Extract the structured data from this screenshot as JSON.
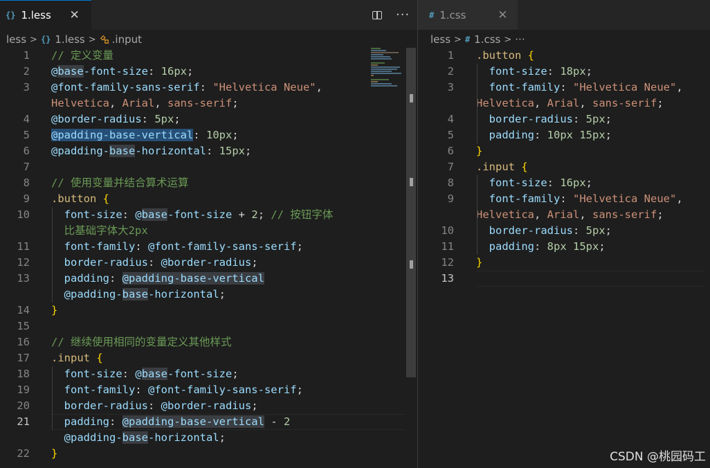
{
  "left": {
    "tab": {
      "label": "1.less",
      "icon": "{}",
      "close": "✕"
    },
    "actions": {
      "split": "split-editor",
      "more": "···"
    },
    "breadcrumb": {
      "folder": "less",
      "file": "1.less",
      "file_icon": "{}",
      "symbol": ".input"
    }
  },
  "right": {
    "tab": {
      "label": "1.css",
      "icon": "#",
      "close": "✕"
    },
    "breadcrumb": {
      "folder": "less",
      "file": "1.css",
      "file_icon": "#",
      "more": "···"
    }
  },
  "watermark": "CSDN @桃园码工",
  "left_code": [
    {
      "n": "1",
      "segs": [
        [
          "c-com",
          "// 定义变量"
        ]
      ]
    },
    {
      "n": "2",
      "segs": [
        [
          "c-var",
          "@"
        ],
        [
          "c-var hl",
          "base"
        ],
        [
          "c-var",
          "-font-size"
        ],
        [
          "c-op",
          ": "
        ],
        [
          "c-num",
          "16px"
        ],
        [
          "c-op",
          ";"
        ]
      ]
    },
    {
      "n": "3",
      "segs": [
        [
          "c-var",
          "@font-family-sans-serif"
        ],
        [
          "c-op",
          ": "
        ],
        [
          "c-str",
          "\"Helvetica Neue\""
        ],
        [
          "c-op",
          ","
        ]
      ]
    },
    {
      "n": "",
      "segs": [
        [
          "c-str",
          "Helvetica"
        ],
        [
          "c-op",
          ", "
        ],
        [
          "c-str",
          "Arial"
        ],
        [
          "c-op",
          ", "
        ],
        [
          "c-str",
          "sans-serif"
        ],
        [
          "c-op",
          ";"
        ]
      ]
    },
    {
      "n": "4",
      "segs": [
        [
          "c-var",
          "@border-radius"
        ],
        [
          "c-op",
          ": "
        ],
        [
          "c-num",
          "5px"
        ],
        [
          "c-op",
          ";"
        ]
      ]
    },
    {
      "n": "5",
      "segs": [
        [
          "c-var hl-sel",
          "@padding-base-vertical"
        ],
        [
          "c-op",
          ": "
        ],
        [
          "c-num",
          "10px"
        ],
        [
          "c-op",
          ";"
        ]
      ]
    },
    {
      "n": "6",
      "segs": [
        [
          "c-var",
          "@padding-"
        ],
        [
          "c-var hl",
          "base"
        ],
        [
          "c-var",
          "-horizontal"
        ],
        [
          "c-op",
          ": "
        ],
        [
          "c-num",
          "15px"
        ],
        [
          "c-op",
          ";"
        ]
      ]
    },
    {
      "n": "7",
      "segs": []
    },
    {
      "n": "8",
      "segs": [
        [
          "c-com",
          "// 使用变量并结合算术运算"
        ]
      ]
    },
    {
      "n": "9",
      "segs": [
        [
          "c-sel",
          ".button "
        ],
        [
          "c-brace",
          "{"
        ]
      ]
    },
    {
      "n": "10",
      "segs": [
        [
          "c-op",
          "  "
        ],
        [
          "c-var",
          "font-size"
        ],
        [
          "c-op",
          ": "
        ],
        [
          "c-var",
          "@"
        ],
        [
          "c-var hl",
          "base"
        ],
        [
          "c-var",
          "-font-size"
        ],
        [
          "c-op",
          " + "
        ],
        [
          "c-num",
          "2"
        ],
        [
          "c-op",
          "; "
        ],
        [
          "c-com",
          "// 按钮字体"
        ]
      ]
    },
    {
      "n": "",
      "segs": [
        [
          "c-com",
          "  比基础字体大2px"
        ]
      ]
    },
    {
      "n": "11",
      "segs": [
        [
          "c-op",
          "  "
        ],
        [
          "c-var",
          "font-family"
        ],
        [
          "c-op",
          ": "
        ],
        [
          "c-var",
          "@font-family-sans-serif"
        ],
        [
          "c-op",
          ";"
        ]
      ]
    },
    {
      "n": "12",
      "segs": [
        [
          "c-op",
          "  "
        ],
        [
          "c-var",
          "border-radius"
        ],
        [
          "c-op",
          ": "
        ],
        [
          "c-var",
          "@border-radius"
        ],
        [
          "c-op",
          ";"
        ]
      ]
    },
    {
      "n": "13",
      "segs": [
        [
          "c-op",
          "  "
        ],
        [
          "c-var",
          "padding"
        ],
        [
          "c-op",
          ": "
        ],
        [
          "c-var hl",
          "@padding-base-vertical"
        ]
      ]
    },
    {
      "n": "",
      "segs": [
        [
          "c-op",
          "  "
        ],
        [
          "c-var",
          "@padding-"
        ],
        [
          "c-var hl",
          "base"
        ],
        [
          "c-var",
          "-horizontal"
        ],
        [
          "c-op",
          ";"
        ]
      ]
    },
    {
      "n": "14",
      "segs": [
        [
          "c-brace",
          "}"
        ]
      ]
    },
    {
      "n": "15",
      "segs": []
    },
    {
      "n": "16",
      "segs": [
        [
          "c-com",
          "// 继续使用相同的变量定义其他样式"
        ]
      ]
    },
    {
      "n": "17",
      "segs": [
        [
          "c-sel",
          ".input "
        ],
        [
          "c-brace",
          "{"
        ]
      ]
    },
    {
      "n": "18",
      "segs": [
        [
          "c-op",
          "  "
        ],
        [
          "c-var",
          "font-size"
        ],
        [
          "c-op",
          ": "
        ],
        [
          "c-var",
          "@"
        ],
        [
          "c-var hl",
          "base"
        ],
        [
          "c-var",
          "-font-size"
        ],
        [
          "c-op",
          ";"
        ]
      ]
    },
    {
      "n": "19",
      "segs": [
        [
          "c-op",
          "  "
        ],
        [
          "c-var",
          "font-family"
        ],
        [
          "c-op",
          ": "
        ],
        [
          "c-var",
          "@font-family-sans-serif"
        ],
        [
          "c-op",
          ";"
        ]
      ]
    },
    {
      "n": "20",
      "segs": [
        [
          "c-op",
          "  "
        ],
        [
          "c-var",
          "border-radius"
        ],
        [
          "c-op",
          ": "
        ],
        [
          "c-var",
          "@border-radius"
        ],
        [
          "c-op",
          ";"
        ]
      ]
    },
    {
      "n": "21",
      "cur": true,
      "segs": [
        [
          "c-op",
          "  "
        ],
        [
          "c-var",
          "padding"
        ],
        [
          "c-op",
          ": "
        ],
        [
          "c-var hl",
          "@padding-base-vertical"
        ],
        [
          "c-op",
          " - "
        ],
        [
          "c-num",
          "2"
        ]
      ]
    },
    {
      "n": "",
      "segs": [
        [
          "c-op",
          "  "
        ],
        [
          "c-var",
          "@padding-"
        ],
        [
          "c-var hl",
          "base"
        ],
        [
          "c-var",
          "-horizontal"
        ],
        [
          "c-op",
          ";"
        ]
      ]
    },
    {
      "n": "22",
      "segs": [
        [
          "c-brace",
          "}"
        ]
      ]
    }
  ],
  "right_code": [
    {
      "n": "1",
      "segs": [
        [
          "c-sel",
          ".button "
        ],
        [
          "c-brace",
          "{"
        ]
      ]
    },
    {
      "n": "2",
      "segs": [
        [
          "c-op",
          "  "
        ],
        [
          "c-var",
          "font-size"
        ],
        [
          "c-op",
          ": "
        ],
        [
          "c-num",
          "18px"
        ],
        [
          "c-op",
          ";"
        ]
      ]
    },
    {
      "n": "3",
      "segs": [
        [
          "c-op",
          "  "
        ],
        [
          "c-var",
          "font-family"
        ],
        [
          "c-op",
          ": "
        ],
        [
          "c-str",
          "\"Helvetica Neue\""
        ],
        [
          "c-op",
          ","
        ]
      ]
    },
    {
      "n": "",
      "segs": [
        [
          "c-str",
          "Helvetica"
        ],
        [
          "c-op",
          ", "
        ],
        [
          "c-str",
          "Arial"
        ],
        [
          "c-op",
          ", "
        ],
        [
          "c-str",
          "sans-serif"
        ],
        [
          "c-op",
          ";"
        ]
      ]
    },
    {
      "n": "4",
      "segs": [
        [
          "c-op",
          "  "
        ],
        [
          "c-var",
          "border-radius"
        ],
        [
          "c-op",
          ": "
        ],
        [
          "c-num",
          "5px"
        ],
        [
          "c-op",
          ";"
        ]
      ]
    },
    {
      "n": "5",
      "segs": [
        [
          "c-op",
          "  "
        ],
        [
          "c-var",
          "padding"
        ],
        [
          "c-op",
          ": "
        ],
        [
          "c-num",
          "10px 15px"
        ],
        [
          "c-op",
          ";"
        ]
      ]
    },
    {
      "n": "6",
      "segs": [
        [
          "c-brace",
          "}"
        ]
      ]
    },
    {
      "n": "7",
      "segs": [
        [
          "c-sel",
          ".input "
        ],
        [
          "c-brace",
          "{"
        ]
      ]
    },
    {
      "n": "8",
      "segs": [
        [
          "c-op",
          "  "
        ],
        [
          "c-var",
          "font-size"
        ],
        [
          "c-op",
          ": "
        ],
        [
          "c-num",
          "16px"
        ],
        [
          "c-op",
          ";"
        ]
      ]
    },
    {
      "n": "9",
      "segs": [
        [
          "c-op",
          "  "
        ],
        [
          "c-var",
          "font-family"
        ],
        [
          "c-op",
          ": "
        ],
        [
          "c-str",
          "\"Helvetica Neue\""
        ],
        [
          "c-op",
          ","
        ]
      ]
    },
    {
      "n": "",
      "segs": [
        [
          "c-str",
          "Helvetica"
        ],
        [
          "c-op",
          ", "
        ],
        [
          "c-str",
          "Arial"
        ],
        [
          "c-op",
          ", "
        ],
        [
          "c-str",
          "sans-serif"
        ],
        [
          "c-op",
          ";"
        ]
      ]
    },
    {
      "n": "10",
      "segs": [
        [
          "c-op",
          "  "
        ],
        [
          "c-var",
          "border-radius"
        ],
        [
          "c-op",
          ": "
        ],
        [
          "c-num",
          "5px"
        ],
        [
          "c-op",
          ";"
        ]
      ]
    },
    {
      "n": "11",
      "segs": [
        [
          "c-op",
          "  "
        ],
        [
          "c-var",
          "padding"
        ],
        [
          "c-op",
          ": "
        ],
        [
          "c-num",
          "8px 15px"
        ],
        [
          "c-op",
          ";"
        ]
      ]
    },
    {
      "n": "12",
      "segs": [
        [
          "c-brace",
          "}"
        ]
      ]
    },
    {
      "n": "13",
      "cur": true,
      "segs": []
    }
  ]
}
